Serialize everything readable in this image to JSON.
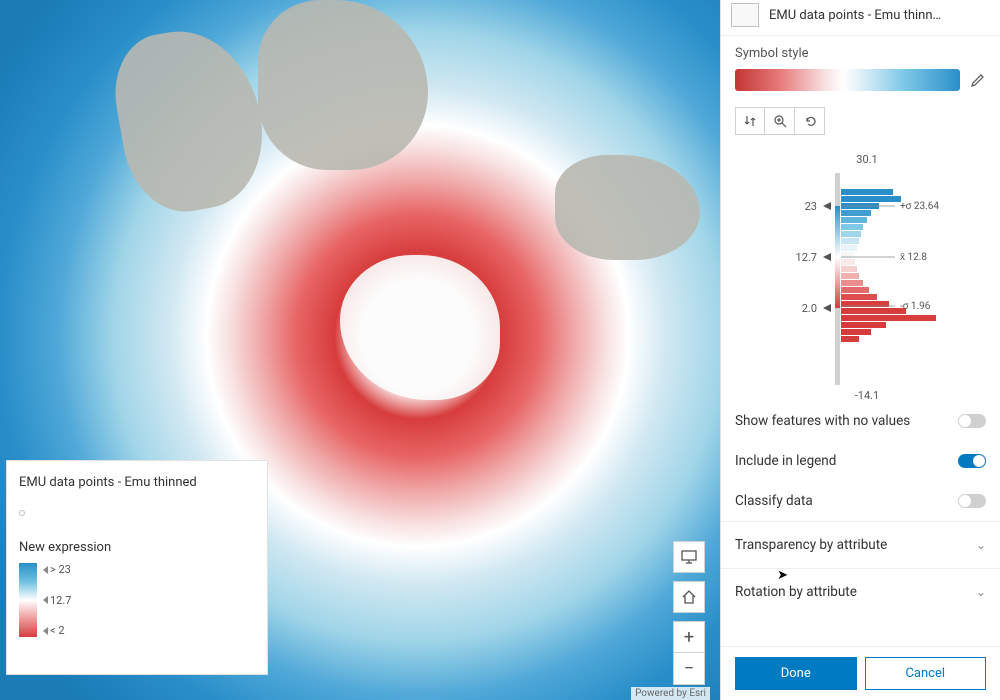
{
  "attribution": "Powered by Esri",
  "legend": {
    "title": "EMU data points - Emu thinned",
    "expression_label": "New expression",
    "labels": {
      "high": "> 23",
      "mid": "12.7",
      "low": "< 2"
    }
  },
  "panel": {
    "header_title": "EMU data points - Emu thinn…",
    "symbol_style_label": "Symbol style",
    "histogram": {
      "max": "30.1",
      "min": "-14.1",
      "handles": {
        "top": "23",
        "mid": "12.7",
        "bottom": "2.0"
      },
      "stats": {
        "sigma_plus": "+σ 23.64",
        "mean": "x̄ 12.8",
        "sigma_minus": "-σ 1.96"
      }
    },
    "toggles": {
      "no_values_label": "Show features with no values",
      "include_legend_label": "Include in legend",
      "classify_label": "Classify data"
    },
    "expanders": {
      "transparency": "Transparency by attribute",
      "rotation": "Rotation by attribute"
    },
    "buttons": {
      "done": "Done",
      "cancel": "Cancel"
    }
  },
  "map_nav": {
    "screen_icon": "monitor",
    "home_icon": "home",
    "zoom_in": "+",
    "zoom_out": "−"
  }
}
